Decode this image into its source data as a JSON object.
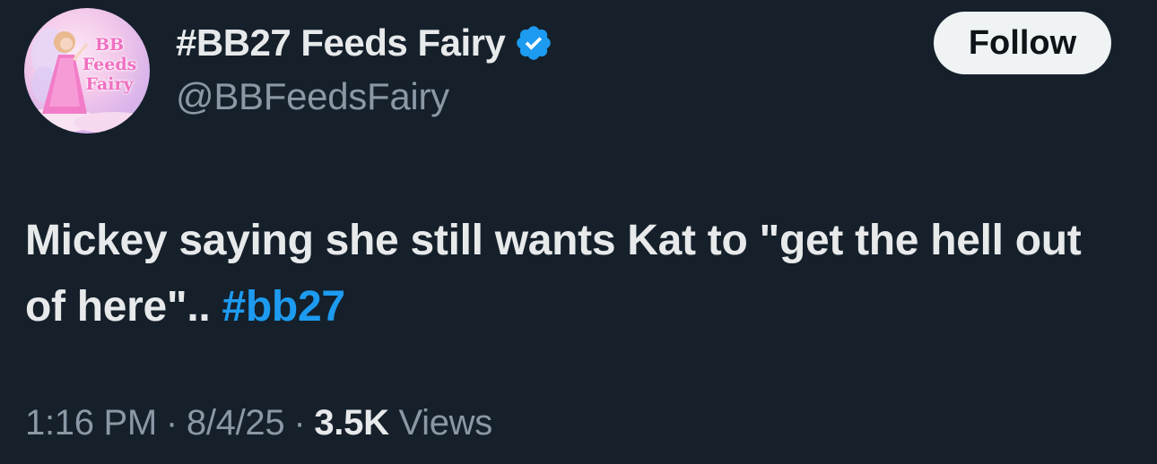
{
  "author": {
    "display_name": "#BB27 Feeds Fairy",
    "handle": "@BBFeedsFairy",
    "verified": true,
    "avatar_text": [
      "BB",
      "Feeds",
      "Fairy"
    ]
  },
  "follow_button": {
    "label": "Follow"
  },
  "tweet": {
    "text": "Mickey saying she still wants Kat to \"get the hell out of here\"..",
    "hashtag": "#bb27"
  },
  "meta": {
    "time": "1:16 PM",
    "date": "8/4/25",
    "separator": "·",
    "views_count": "3.5K",
    "views_label": "Views"
  },
  "colors": {
    "background": "#15202b",
    "text_primary": "#e7e9ea",
    "text_secondary": "#8b98a5",
    "accent": "#1d9bf0",
    "follow_bg": "#eff3f4"
  },
  "icons": {
    "verified": "verified-badge-icon"
  }
}
